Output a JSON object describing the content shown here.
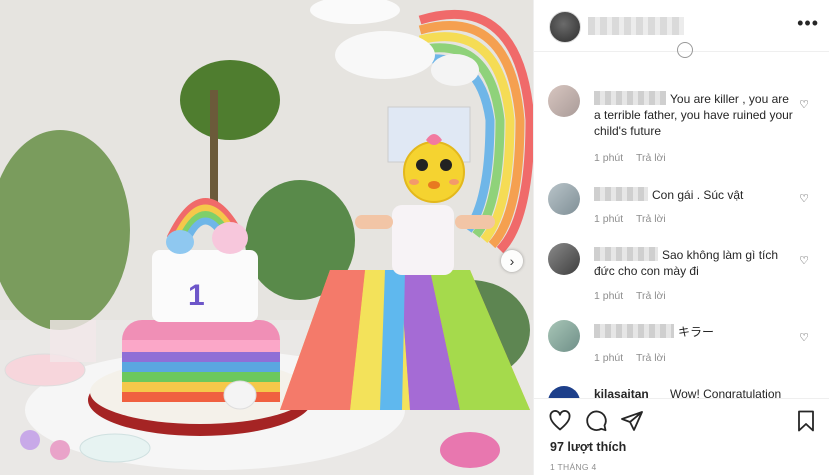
{
  "post": {
    "next_arrow": "›",
    "more_menu": "•••",
    "likes": "97 lượt thích",
    "date": "1 THÁNG 4"
  },
  "comments": [
    {
      "text": "You are killer , you are a terrible father, you have ruined your child's future",
      "time": "1 phút",
      "reply": "Trả lời"
    },
    {
      "text": "Con gái  . Súc vật",
      "time": "1 phút",
      "reply": "Trả lời"
    },
    {
      "text": "Sao không làm gì tích đức cho con mày đi",
      "time": "1 phút",
      "reply": "Trả lời"
    },
    {
      "text": "キラー",
      "time": "1 phút",
      "reply": "Trả lời"
    }
  ],
  "partial_comment": {
    "name": "kilasaitan",
    "text": "Wow! Congratulation"
  },
  "icons": [
    "heart-icon",
    "comment-icon",
    "share-icon",
    "bookmark-icon",
    "more-icon",
    "chevron-right-icon"
  ],
  "colors": {
    "text": "#262626",
    "muted": "#8e8e8e",
    "border": "#efefef"
  }
}
